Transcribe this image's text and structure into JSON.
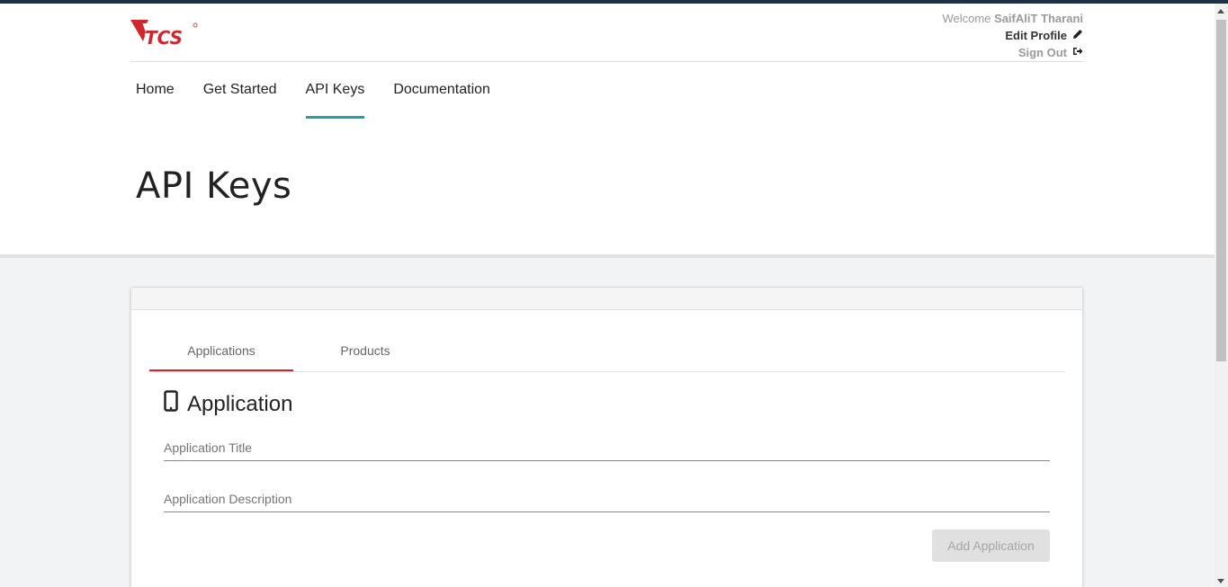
{
  "header": {
    "logo_text": "TCS",
    "welcome_label": "Welcome",
    "username": "SaifAliT Tharani",
    "edit_profile": "Edit Profile",
    "sign_out": "Sign Out"
  },
  "nav": {
    "items": [
      {
        "label": "Home",
        "active": false
      },
      {
        "label": "Get Started",
        "active": false
      },
      {
        "label": "API Keys",
        "active": true
      },
      {
        "label": "Documentation",
        "active": false
      }
    ]
  },
  "page": {
    "title": "API Keys"
  },
  "card": {
    "tabs": [
      {
        "label": "Applications",
        "active": true
      },
      {
        "label": "Products",
        "active": false
      }
    ],
    "section_title": "Application",
    "section_icon": "mobile-phone-icon",
    "fields": {
      "title_placeholder": "Application Title",
      "description_placeholder": "Application Description"
    },
    "add_button": "Add Application"
  },
  "colors": {
    "topbar": "#1d3144",
    "nav_active": "#20a39e",
    "tab_active": "#d0262d",
    "logo_red": "#d0262d"
  }
}
